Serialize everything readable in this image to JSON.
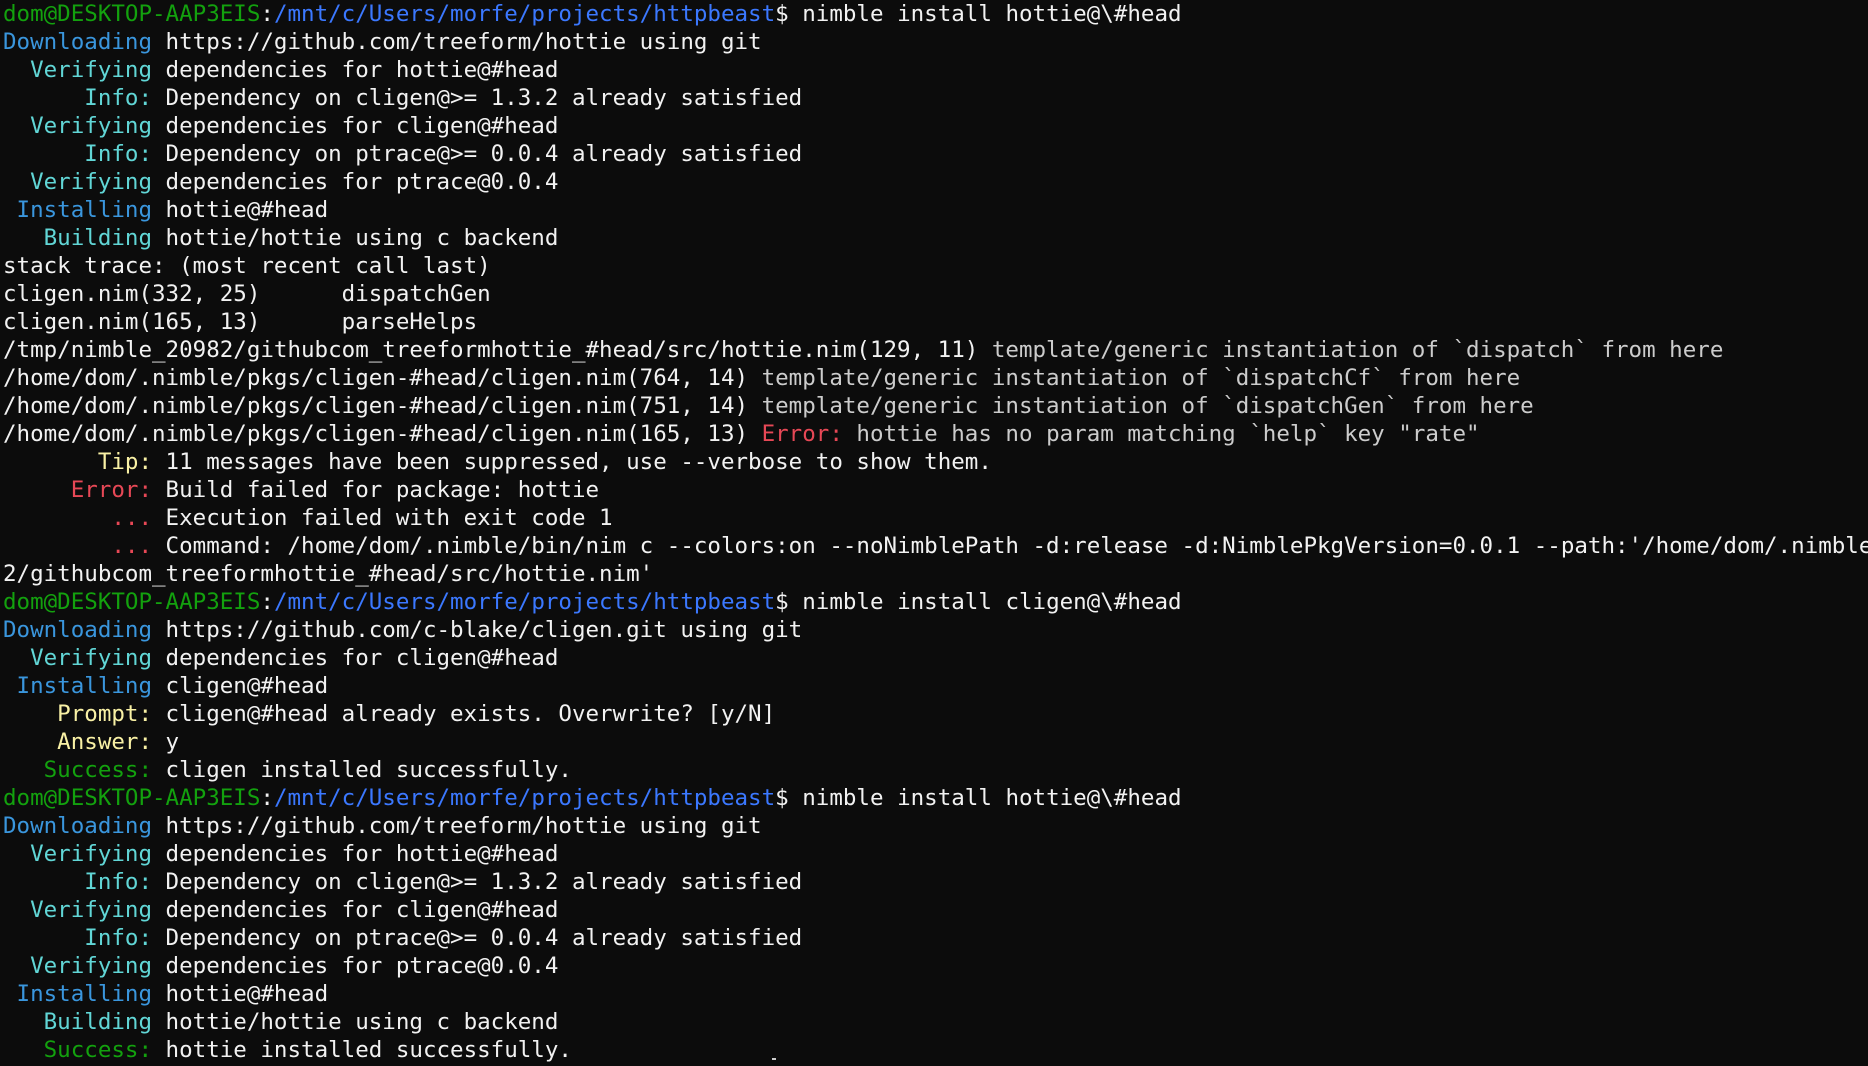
{
  "window": {
    "type": "terminal",
    "background": "#0c0c0c"
  },
  "colors": {
    "green": "#13a10e",
    "blue": "#3b78ff",
    "cyan": "#3a96dd",
    "light_cyan": "#61d6d6",
    "yellow": "#f9f1a5",
    "red": "#e74856",
    "dark_red": "#c50f1f",
    "white": "#f2f2f2",
    "default": "#cccccc"
  },
  "lines": [
    {
      "segs": [
        {
          "t": "dom@DESKTOP-AAP3EIS",
          "c": "green"
        },
        {
          "t": ":",
          "c": "white"
        },
        {
          "t": "/mnt/c/Users/morfe/projects/httpbeast",
          "c": "blue"
        },
        {
          "t": "$ nimble install hottie@\\#head",
          "c": "white"
        }
      ]
    },
    {
      "segs": [
        {
          "t": "Downloading",
          "c": "cyan"
        },
        {
          "t": " https://github.com/treeform/hottie using git",
          "c": "white"
        }
      ]
    },
    {
      "segs": [
        {
          "t": "  Verifying",
          "c": "light_cyan"
        },
        {
          "t": " dependencies for hottie@#head",
          "c": "white"
        }
      ]
    },
    {
      "segs": [
        {
          "t": "      Info:",
          "c": "light_cyan"
        },
        {
          "t": " Dependency on cligen@>= 1.3.2 already satisfied",
          "c": "white"
        }
      ]
    },
    {
      "segs": [
        {
          "t": "  Verifying",
          "c": "light_cyan"
        },
        {
          "t": " dependencies for cligen@#head",
          "c": "white"
        }
      ]
    },
    {
      "segs": [
        {
          "t": "      Info:",
          "c": "light_cyan"
        },
        {
          "t": " Dependency on ptrace@>= 0.0.4 already satisfied",
          "c": "white"
        }
      ]
    },
    {
      "segs": [
        {
          "t": "  Verifying",
          "c": "light_cyan"
        },
        {
          "t": " dependencies for ptrace@0.0.4",
          "c": "white"
        }
      ]
    },
    {
      "segs": [
        {
          "t": " Installing",
          "c": "cyan"
        },
        {
          "t": " hottie@#head",
          "c": "white"
        }
      ]
    },
    {
      "segs": [
        {
          "t": "   Building",
          "c": "light_cyan"
        },
        {
          "t": " hottie/hottie using c backend",
          "c": "white"
        }
      ]
    },
    {
      "segs": [
        {
          "t": "stack trace: (most recent call last)",
          "c": "white"
        }
      ]
    },
    {
      "segs": [
        {
          "t": "cligen.nim(332, 25)      dispatchGen",
          "c": "white"
        }
      ]
    },
    {
      "segs": [
        {
          "t": "cligen.nim(165, 13)      parseHelps",
          "c": "white"
        }
      ]
    },
    {
      "segs": [
        {
          "t": "/tmp/nimble_20982/githubcom_treeformhottie_#head/src/hottie.nim(129, 11)",
          "c": "white"
        },
        {
          "t": " template/generic instantiation of `dispatch` from here",
          "c": "default"
        }
      ]
    },
    {
      "segs": [
        {
          "t": "/home/dom/.nimble/pkgs/cligen-#head/cligen.nim(764, 14)",
          "c": "white"
        },
        {
          "t": " template/generic instantiation of `dispatchCf` from here",
          "c": "default"
        }
      ]
    },
    {
      "segs": [
        {
          "t": "/home/dom/.nimble/pkgs/cligen-#head/cligen.nim(751, 14)",
          "c": "white"
        },
        {
          "t": " template/generic instantiation of `dispatchGen` from here",
          "c": "default"
        }
      ]
    },
    {
      "segs": [
        {
          "t": "/home/dom/.nimble/pkgs/cligen-#head/cligen.nim(165, 13)",
          "c": "white"
        },
        {
          "t": " Error:",
          "c": "red"
        },
        {
          "t": " hottie has no param matching `help` key \"rate\"",
          "c": "default"
        }
      ]
    },
    {
      "segs": [
        {
          "t": "       Tip:",
          "c": "yellow"
        },
        {
          "t": " 11 messages have been suppressed, use --verbose to show them.",
          "c": "white"
        }
      ]
    },
    {
      "segs": [
        {
          "t": "     Error:",
          "c": "red"
        },
        {
          "t": " Build failed for package: hottie",
          "c": "white"
        }
      ]
    },
    {
      "segs": [
        {
          "t": "        ...",
          "c": "red"
        },
        {
          "t": " Execution failed with exit code 1",
          "c": "white"
        }
      ]
    },
    {
      "segs": [
        {
          "t": "        ...",
          "c": "red"
        },
        {
          "t": " Command: /home/dom/.nimble/bin/nim c --colors:on --noNimblePath -d:release -d:NimblePkgVersion=0.0.1 --path:'/home/dom/.nimble/pkgs/",
          "c": "white"
        }
      ]
    },
    {
      "segs": [
        {
          "t": "2/githubcom_treeformhottie_#head/src/hottie.nim'",
          "c": "white"
        }
      ]
    },
    {
      "segs": [
        {
          "t": "dom@DESKTOP-AAP3EIS",
          "c": "green"
        },
        {
          "t": ":",
          "c": "white"
        },
        {
          "t": "/mnt/c/Users/morfe/projects/httpbeast",
          "c": "blue"
        },
        {
          "t": "$ nimble install cligen@\\#head",
          "c": "white"
        }
      ]
    },
    {
      "segs": [
        {
          "t": "Downloading",
          "c": "cyan"
        },
        {
          "t": " https://github.com/c-blake/cligen.git using git",
          "c": "white"
        }
      ]
    },
    {
      "segs": [
        {
          "t": "  Verifying",
          "c": "light_cyan"
        },
        {
          "t": " dependencies for cligen@#head",
          "c": "white"
        }
      ]
    },
    {
      "segs": [
        {
          "t": " Installing",
          "c": "cyan"
        },
        {
          "t": " cligen@#head",
          "c": "white"
        }
      ]
    },
    {
      "segs": [
        {
          "t": "    Prompt:",
          "c": "yellow"
        },
        {
          "t": " cligen@#head already exists. Overwrite? [y/N]",
          "c": "white"
        }
      ]
    },
    {
      "segs": [
        {
          "t": "    Answer:",
          "c": "yellow"
        },
        {
          "t": " y",
          "c": "white"
        }
      ]
    },
    {
      "segs": [
        {
          "t": "   Success:",
          "c": "green"
        },
        {
          "t": " cligen installed successfully.",
          "c": "white"
        }
      ]
    },
    {
      "segs": [
        {
          "t": "dom@DESKTOP-AAP3EIS",
          "c": "green"
        },
        {
          "t": ":",
          "c": "white"
        },
        {
          "t": "/mnt/c/Users/morfe/projects/httpbeast",
          "c": "blue"
        },
        {
          "t": "$ nimble install hottie@\\#head",
          "c": "white"
        }
      ]
    },
    {
      "segs": [
        {
          "t": "Downloading",
          "c": "cyan"
        },
        {
          "t": " https://github.com/treeform/hottie using git",
          "c": "white"
        }
      ]
    },
    {
      "segs": [
        {
          "t": "  Verifying",
          "c": "light_cyan"
        },
        {
          "t": " dependencies for hottie@#head",
          "c": "white"
        }
      ]
    },
    {
      "segs": [
        {
          "t": "      Info:",
          "c": "light_cyan"
        },
        {
          "t": " Dependency on cligen@>= 1.3.2 already satisfied",
          "c": "white"
        }
      ]
    },
    {
      "segs": [
        {
          "t": "  Verifying",
          "c": "light_cyan"
        },
        {
          "t": " dependencies for cligen@#head",
          "c": "white"
        }
      ]
    },
    {
      "segs": [
        {
          "t": "      Info:",
          "c": "light_cyan"
        },
        {
          "t": " Dependency on ptrace@>= 0.0.4 already satisfied",
          "c": "white"
        }
      ]
    },
    {
      "segs": [
        {
          "t": "  Verifying",
          "c": "light_cyan"
        },
        {
          "t": " dependencies for ptrace@0.0.4",
          "c": "white"
        }
      ]
    },
    {
      "segs": [
        {
          "t": " Installing",
          "c": "cyan"
        },
        {
          "t": " hottie@#head",
          "c": "white"
        }
      ]
    },
    {
      "segs": [
        {
          "t": "   Building",
          "c": "light_cyan"
        },
        {
          "t": " hottie/hottie using c backend",
          "c": "white"
        }
      ]
    },
    {
      "segs": [
        {
          "t": "   Success:",
          "c": "green"
        },
        {
          "t": " hottie installed successfully.",
          "c": "white"
        }
      ]
    }
  ]
}
